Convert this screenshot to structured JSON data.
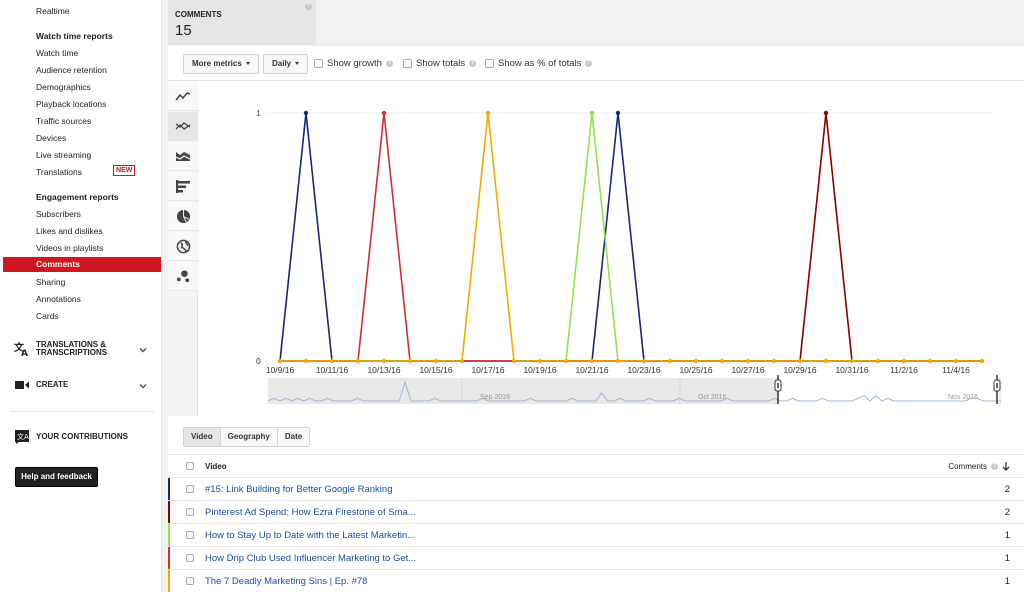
{
  "sidebar": {
    "realtime": "Realtime",
    "watch_time_reports": "Watch time reports",
    "watch_items": [
      "Watch time",
      "Audience retention",
      "Demographics",
      "Playback locations",
      "Traffic sources",
      "Devices",
      "Live streaming",
      "Translations"
    ],
    "new_badge": "NEW",
    "engagement_reports": "Engagement reports",
    "engagement_items": [
      "Subscribers",
      "Likes and dislikes",
      "Videos in playlists",
      "Comments",
      "Sharing",
      "Annotations",
      "Cards"
    ],
    "active_item": "Comments",
    "sections": {
      "translations_l1": "TRANSLATIONS &",
      "translations_l2": "TRANSCRIPTIONS",
      "create": "CREATE",
      "contributions": "YOUR CONTRIBUTIONS"
    },
    "help_button": "Help and feedback"
  },
  "metric": {
    "label": "COMMENTS",
    "value": "15"
  },
  "toolbar": {
    "more_metrics": "More metrics",
    "interval": "Daily",
    "show_growth": "Show growth",
    "show_totals": "Show totals",
    "show_pct": "Show as % of totals"
  },
  "chart_types": [
    "line-chart-icon",
    "multi-line-chart-icon",
    "stacked-area-icon",
    "bar-chart-icon",
    "pie-chart-icon",
    "map-icon",
    "bubble-chart-icon"
  ],
  "active_chart_type": "multi-line-chart-icon",
  "chart_data": {
    "type": "line",
    "title": "",
    "xlabel": "",
    "ylabel": "Comments",
    "ylim": [
      0,
      1
    ],
    "y_ticks": [
      "0",
      "1"
    ],
    "x": [
      "10/9/16",
      "10/10/16",
      "10/11/16",
      "10/12/16",
      "10/13/16",
      "10/14/16",
      "10/15/16",
      "10/16/16",
      "10/17/16",
      "10/18/16",
      "10/19/16",
      "10/20/16",
      "10/21/16",
      "10/22/16",
      "10/23/16",
      "10/24/16",
      "10/25/16",
      "10/26/16",
      "10/27/16",
      "10/28/16",
      "10/29/16",
      "10/30/16",
      "10/31/16",
      "11/1/16",
      "11/2/16",
      "11/3/16",
      "11/4/16",
      "11/5/16"
    ],
    "x_tick_labels": [
      "10/9/16",
      "10/11/16",
      "10/13/16",
      "10/15/16",
      "10/17/16",
      "10/19/16",
      "10/21/16",
      "10/23/16",
      "10/25/16",
      "10/27/16",
      "10/29/16",
      "10/31/16",
      "11/2/16",
      "11/4/16"
    ],
    "series": [
      {
        "name": "#15: Link Building for Better Google Ranking",
        "color": "#1a237e",
        "values": [
          0,
          1,
          0,
          0,
          0,
          0,
          0,
          0,
          0,
          0,
          0,
          0,
          0,
          1,
          0,
          0,
          0,
          0,
          0,
          0,
          0,
          0,
          0,
          0,
          0,
          0,
          0,
          0
        ]
      },
      {
        "name": "Pinterest Ad Spend: How Ezra Firestone of Sma...",
        "color": "#8b0000",
        "values": [
          0,
          0,
          0,
          0,
          0,
          0,
          0,
          0,
          0,
          0,
          0,
          0,
          0,
          0,
          0,
          0,
          0,
          0,
          0,
          0,
          0,
          1,
          0,
          0,
          0,
          0,
          0,
          0
        ]
      },
      {
        "name": "How to Stay Up to Date with the Latest Marketin...",
        "color": "#8ee34a",
        "values": [
          0,
          0,
          0,
          0,
          0,
          0,
          0,
          0,
          0,
          0,
          0,
          0,
          1,
          0,
          0,
          0,
          0,
          0,
          0,
          0,
          0,
          0,
          0,
          0,
          0,
          0,
          0,
          0
        ]
      },
      {
        "name": "How Drip Club Used Influencer Marketing to Get...",
        "color": "#d32f2f",
        "values": [
          0,
          0,
          0,
          0,
          1,
          0,
          0,
          0,
          0,
          0,
          0,
          0,
          0,
          0,
          0,
          0,
          0,
          0,
          0,
          0,
          0,
          0,
          0,
          0,
          0,
          0,
          0,
          0
        ]
      },
      {
        "name": "The 7 Deadly Marketing Sins | Ep. #78",
        "color": "#f2a900",
        "values": [
          0,
          0,
          0,
          0,
          0,
          0,
          0,
          0,
          1,
          0,
          0,
          0,
          0,
          0,
          0,
          0,
          0,
          0,
          0,
          0,
          0,
          0,
          0,
          0,
          0,
          0,
          0,
          0
        ]
      }
    ],
    "navigator": {
      "month_labels": [
        "Sep 2016",
        "Oct 2016",
        "Nov 2016"
      ],
      "selected_range": [
        "10/9/16",
        "11/5/16"
      ]
    },
    "grid": true,
    "legend": "none"
  },
  "breakdown_tabs": [
    "Video",
    "Geography",
    "Date"
  ],
  "active_tab": "Video",
  "table": {
    "columns": [
      "Video",
      "Comments"
    ],
    "sort": "Comments descending",
    "rows": [
      {
        "title": "#15: Link Building for Better Google Ranking",
        "comments": "2",
        "color": "#1a237e"
      },
      {
        "title": "Pinterest Ad Spend: How Ezra Firestone of Sma...",
        "comments": "2",
        "color": "#8b0000"
      },
      {
        "title": "How to Stay Up to Date with the Latest Marketin...",
        "comments": "1",
        "color": "#8ee34a"
      },
      {
        "title": "How Drip Club Used Influencer Marketing to Get...",
        "comments": "1",
        "color": "#d32f2f"
      },
      {
        "title": "The 7 Deadly Marketing Sins | Ep. #78",
        "comments": "1",
        "color": "#f2a900"
      }
    ]
  }
}
